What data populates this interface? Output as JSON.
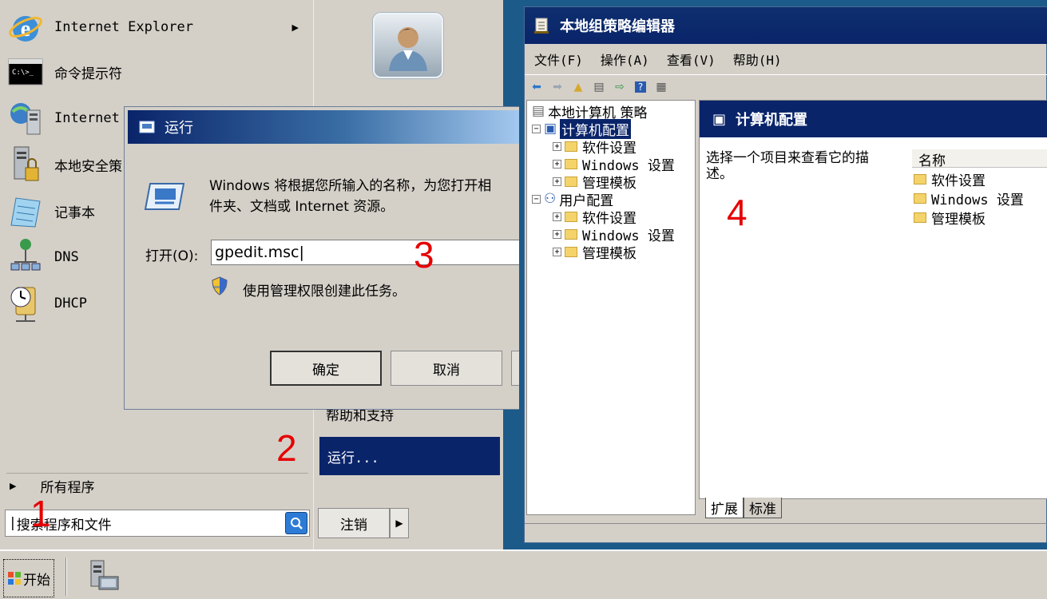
{
  "start_menu": {
    "programs": [
      {
        "label": "Internet Explorer",
        "icon": "internet-explorer-icon",
        "has_submenu": true
      },
      {
        "label": "命令提示符",
        "icon": "command-prompt-icon"
      },
      {
        "label": "Internet",
        "icon": "iis-manager-icon"
      },
      {
        "label": "本地安全策",
        "icon": "local-security-policy-icon"
      },
      {
        "label": "记事本",
        "icon": "notepad-icon"
      },
      {
        "label": "DNS",
        "icon": "dns-icon"
      },
      {
        "label": "DHCP",
        "icon": "dhcp-icon"
      }
    ],
    "all_programs": "所有程序",
    "search_placeholder": "搜索程序和文件",
    "logoff": "注销",
    "help_support": "帮助和支持",
    "run": "运行..."
  },
  "annotations": [
    "1",
    "2",
    "3",
    "4"
  ],
  "run_dialog": {
    "title": "运行",
    "description": "Windows 将根据您所输入的名称，为您打开相应的程序、文件夹、文档或 Internet 资源。",
    "desc_line1": "Windows 将根据您所输入的名称，为您打开相",
    "desc_line2": "件夹、文档或 Internet 资源。",
    "open_label": "打开(O):",
    "open_value": "gpedit.msc",
    "admin_text": "使用管理权限创建此任务。",
    "ok": "确定",
    "cancel": "取消"
  },
  "gp_editor": {
    "title": "本地组策略编辑器",
    "menu": [
      "文件(F)",
      "操作(A)",
      "查看(V)",
      "帮助(H)"
    ],
    "tree": {
      "root": "本地计算机 策略",
      "computer_config": "计算机配置",
      "user_config": "用户配置",
      "children": [
        "软件设置",
        "Windows 设置",
        "管理模板"
      ]
    },
    "right_header": "计算机配置",
    "description": "选择一个项目来查看它的描述。",
    "desc_line1": "选择一个项目来查看它的描",
    "desc_line2": "述。",
    "column_name": "名称",
    "items": [
      "软件设置",
      "Windows 设置",
      "管理模板"
    ],
    "tabs": [
      "扩展",
      "标准"
    ]
  },
  "taskbar": {
    "start": "开始"
  },
  "colors": {
    "title_bar": "#0a246a",
    "selection": "#0a246a",
    "window_bg": "#d4d0c8",
    "annotation": "#e60000"
  }
}
